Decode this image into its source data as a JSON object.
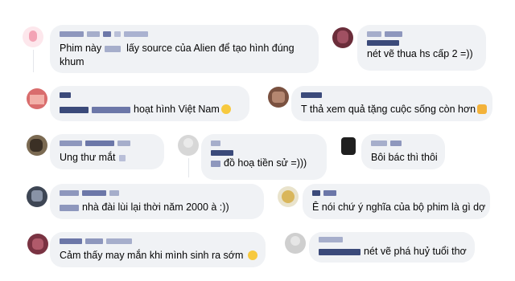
{
  "comments": [
    {
      "id": "c1",
      "text": "Phim này  lấy source của Alien để tạo hình đúng khum",
      "avatar_color": "#f3b9c4",
      "emoji": ""
    },
    {
      "id": "c2",
      "text": "nét vẽ thua hs cấp 2 =))",
      "avatar_color": "#6b2d3a",
      "emoji": ""
    },
    {
      "id": "c3",
      "text": "hoạt hình Việt Nam",
      "avatar_color": "#d96d6d",
      "emoji": "sweat-smile-emoji"
    },
    {
      "id": "c4",
      "text": "T thả xem quả tặng cuộc sống còn hơn",
      "avatar_color": "#7a5140",
      "emoji": "crying-cat-emoji"
    },
    {
      "id": "c5",
      "text": "Ung thư mắt",
      "avatar_color": "#7b6a52",
      "emoji": ""
    },
    {
      "id": "c6",
      "text": "đồ hoạ tiền sử =)))",
      "avatar_color": "#c9c9c9",
      "emoji": ""
    },
    {
      "id": "c7",
      "text": "Bôi bác thì thôi",
      "avatar_color": "#2a2a2a",
      "emoji": ""
    },
    {
      "id": "c8",
      "text": "nhà đài lùi lại thời năm 2000 à :))",
      "avatar_color": "#3e4654",
      "emoji": ""
    },
    {
      "id": "c9",
      "text": "Ê nói chứ ý nghĩa của bộ phim là gì dợ",
      "avatar_color": "#d9b65b",
      "emoji": ""
    },
    {
      "id": "c10",
      "text": "Cảm thấy may mắn khi mình sinh ra sớm",
      "avatar_color": "#7a3342",
      "emoji": "smile-emoji"
    },
    {
      "id": "c11",
      "text": "nét vẽ phá huỷ tuổi thơ",
      "avatar_color": "#bfbfbf",
      "emoji": ""
    }
  ],
  "colors": {
    "bubble": "#f0f2f5",
    "blur_name": "#9aa3c4",
    "blur_dark": "#3b4a7a"
  }
}
